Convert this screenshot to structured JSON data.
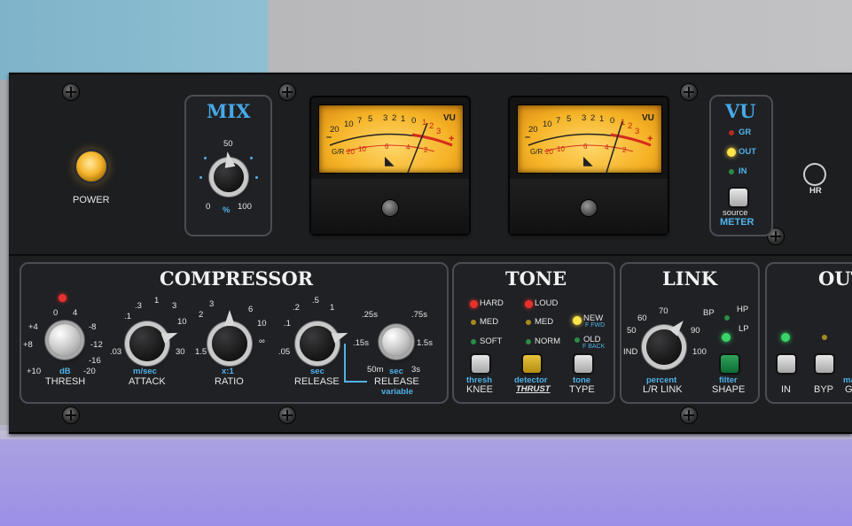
{
  "power": {
    "label": "POWER"
  },
  "mix": {
    "title": "MIX",
    "top": "50",
    "min": "0",
    "unit": "%",
    "max": "100"
  },
  "meters": [
    {
      "scale": [
        "20",
        "10",
        "7",
        "5",
        "3",
        "2",
        "1",
        "0",
        "1",
        "2",
        "3"
      ],
      "vu": "VU",
      "gr": "G/R",
      "low": [
        "20",
        "10",
        "6",
        "4",
        "2"
      ],
      "minus": "–",
      "plus": "+"
    },
    {
      "scale": [
        "20",
        "10",
        "7",
        "5",
        "3",
        "2",
        "1",
        "0",
        "1",
        "2",
        "3"
      ],
      "vu": "VU",
      "gr": "G/R",
      "low": [
        "20",
        "10",
        "6",
        "4",
        "2"
      ],
      "minus": "–",
      "plus": "+"
    }
  ],
  "vu": {
    "title": "VU",
    "gr": "GR",
    "out": "OUT",
    "in": "IN",
    "source": "source",
    "meter": "METER"
  },
  "hr": {
    "label": "HR"
  },
  "compressor": {
    "title": "COMPRESSOR",
    "thresh": {
      "label": "THRESH",
      "unit": "dB",
      "scale": [
        "0",
        "4",
        "-8",
        "-12",
        "-16",
        "-20",
        "+10",
        "+8",
        "+4"
      ]
    },
    "attack": {
      "label": "ATTACK",
      "unit": "m/sec",
      "scale": [
        ".1",
        ".3",
        "1",
        "3",
        "10",
        "30",
        ".03"
      ]
    },
    "ratio": {
      "label": "RATIO",
      "unit": "x:1",
      "scale": [
        "2",
        "3",
        "6",
        "10",
        "∞",
        "1.5"
      ]
    },
    "release": {
      "label": "RELEASE",
      "unit": "sec",
      "scale": [
        ".1",
        ".2",
        ".5",
        "1",
        ".05"
      ]
    },
    "release_var": {
      "label": "RELEASE",
      "unit": "sec",
      "sub": "variable",
      "scale": [
        ".25s",
        ".75s",
        "1.5s",
        ".15s",
        "3s",
        "50m"
      ]
    }
  },
  "tone": {
    "title": "TONE",
    "knee": {
      "opt1": "HARD",
      "opt2": "MED",
      "opt3": "SOFT",
      "top": "thresh",
      "label": "KNEE"
    },
    "detector": {
      "opt1": "LOUD",
      "opt2": "MED",
      "opt3": "NORM",
      "top": "detector",
      "label": "THRUST"
    },
    "type": {
      "opt1": "NEW",
      "opt1_sub": "F FWD",
      "opt2": "OLD",
      "opt2_sub": "F BACK",
      "top": "tone",
      "label": "TYPE"
    }
  },
  "link": {
    "title": "LINK",
    "scale": [
      "70",
      "60",
      "50",
      "IND",
      "90",
      "100"
    ],
    "unit": "percent",
    "label": "L/R LINK",
    "bp": "BP",
    "hp": "HP",
    "lp": "LP",
    "filter": "filter",
    "shape": "SHAPE"
  },
  "output": {
    "title": "OUT",
    "in": "IN",
    "byp": "BYP",
    "extra": "G",
    "extra_top": "ma"
  },
  "colors": {
    "blue": "#4fb2ea",
    "amber": "#f5b225",
    "red": "#e8312c",
    "green": "#39d36a"
  }
}
